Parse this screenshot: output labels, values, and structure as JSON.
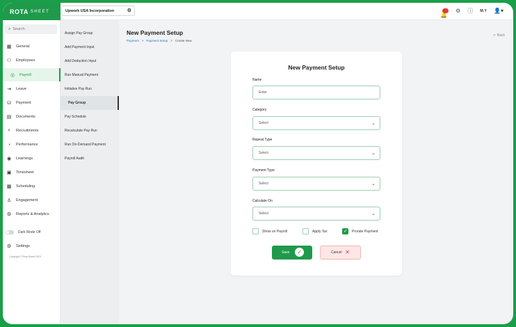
{
  "logo": {
    "main": "ROTA",
    "sub": "SHEET"
  },
  "header": {
    "company": "Upwork USA Incorporation",
    "user_initials": "M.Y"
  },
  "sidebar": {
    "search_placeholder": "Search",
    "items": [
      {
        "label": "General",
        "icon": "general-icon"
      },
      {
        "label": "Employees",
        "icon": "employees-icon"
      },
      {
        "label": "Payroll",
        "icon": "payroll-icon",
        "active": true
      },
      {
        "label": "Leave",
        "icon": "leave-icon"
      },
      {
        "label": "Payment",
        "icon": "payment-icon"
      },
      {
        "label": "Documents",
        "icon": "documents-icon"
      },
      {
        "label": "Recruitments",
        "icon": "recruitments-icon"
      },
      {
        "label": "Performance",
        "icon": "performance-icon"
      },
      {
        "label": "Learnings",
        "icon": "learnings-icon"
      },
      {
        "label": "Timesheet",
        "icon": "timesheet-icon"
      },
      {
        "label": "Scheduling",
        "icon": "scheduling-icon"
      },
      {
        "label": "Engagement",
        "icon": "engagement-icon"
      },
      {
        "label": "Reports & Analytics",
        "icon": "reports-icon"
      }
    ],
    "dark_mode": "Dark Mode Off",
    "settings": "Settings",
    "copyright": "Copyright © Rota Sheet 2023"
  },
  "submenu": {
    "items": [
      {
        "label": "Assign Pay Group"
      },
      {
        "label": "Add Payment Input"
      },
      {
        "label": "Add Deduction Input"
      },
      {
        "label": "Run Manual Payment"
      },
      {
        "label": "Initiative Pay Run"
      },
      {
        "label": "Pay Group",
        "active": true
      },
      {
        "label": "Pay Schedule"
      },
      {
        "label": "Recalculate Pay Run"
      },
      {
        "label": "Run On-Demand Payment"
      },
      {
        "label": "Payroll Audit"
      }
    ]
  },
  "main": {
    "title": "New Payment Setup",
    "breadcrumb": [
      "Payment",
      "Payment Setup",
      "Create New"
    ],
    "back": "Back"
  },
  "form": {
    "title": "New Payment Setup",
    "name_label": "Name",
    "name_placeholder": "Enter",
    "category_label": "Category",
    "category_value": "Select",
    "repeat_label": "Repeat Type",
    "repeat_value": "Select",
    "payment_type_label": "Payment Type",
    "payment_type_value": "Select",
    "calculate_label": "Calculate On",
    "calculate_value": "Select",
    "checkboxes": [
      {
        "label": "Show on Payroll",
        "checked": false
      },
      {
        "label": "Apply Tax",
        "checked": false
      },
      {
        "label": "Prorate Payment",
        "checked": true
      }
    ],
    "save": "Save",
    "cancel": "Cancel"
  },
  "colors": {
    "accent": "#1f9a4b",
    "danger": "#e63b30"
  }
}
